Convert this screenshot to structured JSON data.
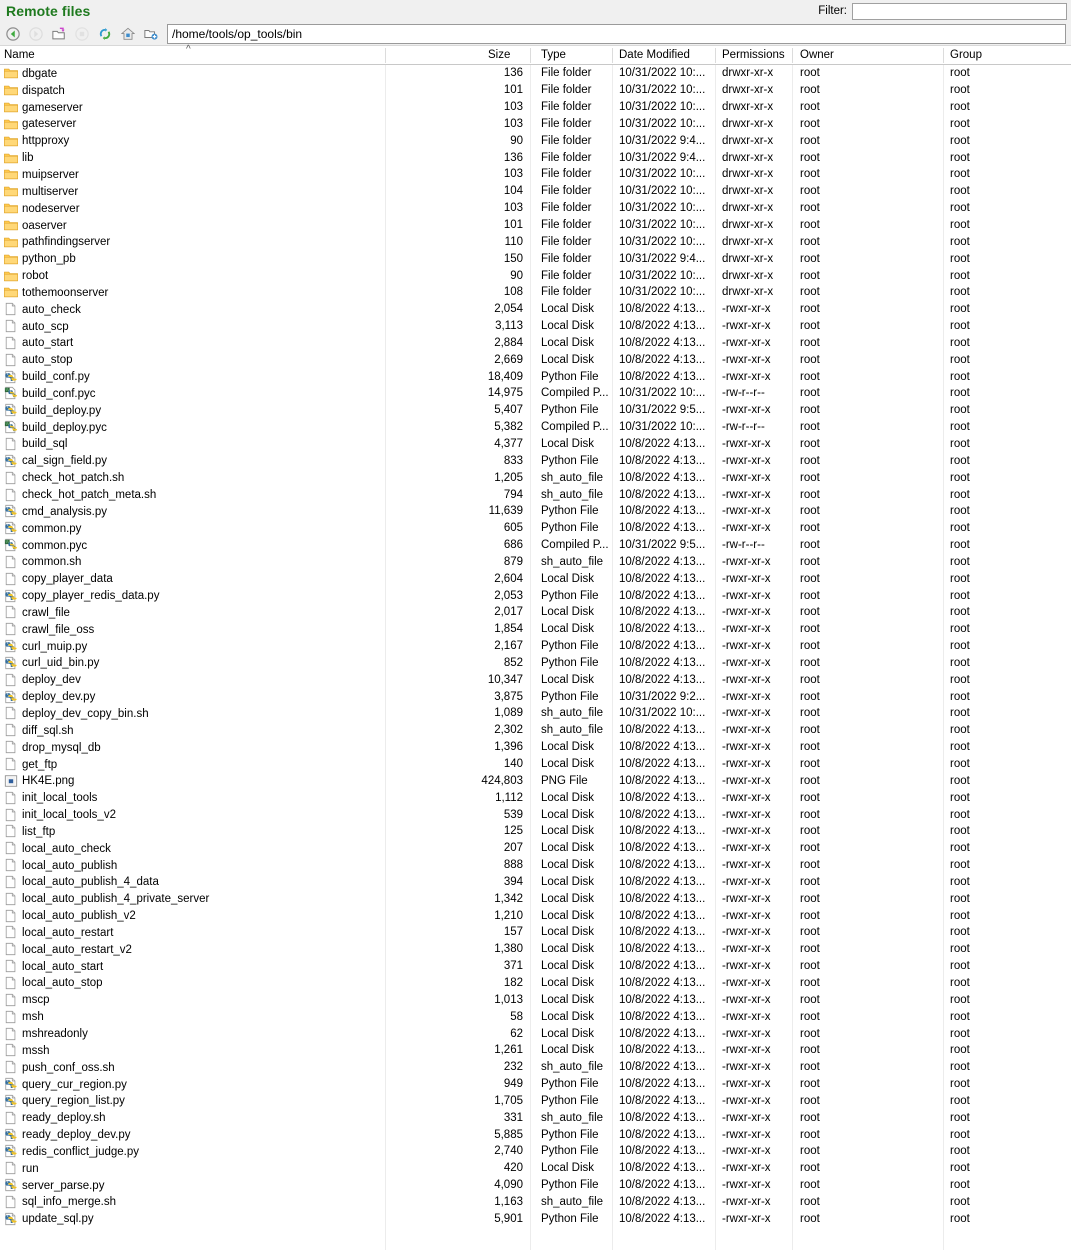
{
  "window": {
    "title": "Remote files"
  },
  "filter": {
    "label": "Filter:",
    "value": "",
    "placeholder": ""
  },
  "toolbar": {
    "buttons": [
      {
        "name": "back-icon",
        "enabled": true
      },
      {
        "name": "forward-icon",
        "enabled": false
      },
      {
        "name": "parent-directory-icon",
        "enabled": true
      },
      {
        "name": "stop-icon",
        "enabled": false
      },
      {
        "name": "refresh-icon",
        "enabled": true
      },
      {
        "name": "home-icon",
        "enabled": true
      },
      {
        "name": "new-folder-icon",
        "enabled": true
      }
    ],
    "path": "/home/tools/op_tools/bin"
  },
  "columns": {
    "name": "Name",
    "size": "Size",
    "type": "Type",
    "date_modified": "Date Modified",
    "permissions": "Permissions",
    "owner": "Owner",
    "group": "Group",
    "sort_indicator": "^",
    "sorted_by": "Name",
    "sort_direction": "ascending"
  },
  "colors": {
    "title": "#1f7a1f",
    "folder": "#ffc84a",
    "background": "#ffffff",
    "toolbar_bg": "#f0f0f0",
    "divider": "#ececec"
  },
  "files": [
    {
      "icon": "folder-icon",
      "name": "dbgate",
      "size": "136",
      "type": "File folder",
      "date": "10/31/2022 10:...",
      "perm": "drwxr-xr-x",
      "owner": "root",
      "group": "root"
    },
    {
      "icon": "folder-icon",
      "name": "dispatch",
      "size": "101",
      "type": "File folder",
      "date": "10/31/2022 10:...",
      "perm": "drwxr-xr-x",
      "owner": "root",
      "group": "root"
    },
    {
      "icon": "folder-icon",
      "name": "gameserver",
      "size": "103",
      "type": "File folder",
      "date": "10/31/2022 10:...",
      "perm": "drwxr-xr-x",
      "owner": "root",
      "group": "root"
    },
    {
      "icon": "folder-icon",
      "name": "gateserver",
      "size": "103",
      "type": "File folder",
      "date": "10/31/2022 10:...",
      "perm": "drwxr-xr-x",
      "owner": "root",
      "group": "root"
    },
    {
      "icon": "folder-icon",
      "name": "httpproxy",
      "size": "90",
      "type": "File folder",
      "date": "10/31/2022 9:4...",
      "perm": "drwxr-xr-x",
      "owner": "root",
      "group": "root"
    },
    {
      "icon": "folder-icon",
      "name": "lib",
      "size": "136",
      "type": "File folder",
      "date": "10/31/2022 9:4...",
      "perm": "drwxr-xr-x",
      "owner": "root",
      "group": "root"
    },
    {
      "icon": "folder-icon",
      "name": "muipserver",
      "size": "103",
      "type": "File folder",
      "date": "10/31/2022 10:...",
      "perm": "drwxr-xr-x",
      "owner": "root",
      "group": "root"
    },
    {
      "icon": "folder-icon",
      "name": "multiserver",
      "size": "104",
      "type": "File folder",
      "date": "10/31/2022 10:...",
      "perm": "drwxr-xr-x",
      "owner": "root",
      "group": "root"
    },
    {
      "icon": "folder-icon",
      "name": "nodeserver",
      "size": "103",
      "type": "File folder",
      "date": "10/31/2022 10:...",
      "perm": "drwxr-xr-x",
      "owner": "root",
      "group": "root"
    },
    {
      "icon": "folder-icon",
      "name": "oaserver",
      "size": "101",
      "type": "File folder",
      "date": "10/31/2022 10:...",
      "perm": "drwxr-xr-x",
      "owner": "root",
      "group": "root"
    },
    {
      "icon": "folder-icon",
      "name": "pathfindingserver",
      "size": "110",
      "type": "File folder",
      "date": "10/31/2022 10:...",
      "perm": "drwxr-xr-x",
      "owner": "root",
      "group": "root"
    },
    {
      "icon": "folder-icon",
      "name": "python_pb",
      "size": "150",
      "type": "File folder",
      "date": "10/31/2022 9:4...",
      "perm": "drwxr-xr-x",
      "owner": "root",
      "group": "root"
    },
    {
      "icon": "folder-icon",
      "name": "robot",
      "size": "90",
      "type": "File folder",
      "date": "10/31/2022 10:...",
      "perm": "drwxr-xr-x",
      "owner": "root",
      "group": "root"
    },
    {
      "icon": "folder-icon",
      "name": "tothemoonserver",
      "size": "108",
      "type": "File folder",
      "date": "10/31/2022 10:...",
      "perm": "drwxr-xr-x",
      "owner": "root",
      "group": "root"
    },
    {
      "icon": "file-icon",
      "name": "auto_check",
      "size": "2,054",
      "type": "Local Disk",
      "date": "10/8/2022 4:13...",
      "perm": "-rwxr-xr-x",
      "owner": "root",
      "group": "root"
    },
    {
      "icon": "file-icon",
      "name": "auto_scp",
      "size": "3,113",
      "type": "Local Disk",
      "date": "10/8/2022 4:13...",
      "perm": "-rwxr-xr-x",
      "owner": "root",
      "group": "root"
    },
    {
      "icon": "file-icon",
      "name": "auto_start",
      "size": "2,884",
      "type": "Local Disk",
      "date": "10/8/2022 4:13...",
      "perm": "-rwxr-xr-x",
      "owner": "root",
      "group": "root"
    },
    {
      "icon": "file-icon",
      "name": "auto_stop",
      "size": "2,669",
      "type": "Local Disk",
      "date": "10/8/2022 4:13...",
      "perm": "-rwxr-xr-x",
      "owner": "root",
      "group": "root"
    },
    {
      "icon": "python-icon",
      "name": "build_conf.py",
      "size": "18,409",
      "type": "Python File",
      "date": "10/8/2022 4:13...",
      "perm": "-rwxr-xr-x",
      "owner": "root",
      "group": "root"
    },
    {
      "icon": "pyc-icon",
      "name": "build_conf.pyc",
      "size": "14,975",
      "type": "Compiled P...",
      "date": "10/31/2022 10:...",
      "perm": "-rw-r--r--",
      "owner": "root",
      "group": "root"
    },
    {
      "icon": "python-icon",
      "name": "build_deploy.py",
      "size": "5,407",
      "type": "Python File",
      "date": "10/31/2022 9:5...",
      "perm": "-rwxr-xr-x",
      "owner": "root",
      "group": "root"
    },
    {
      "icon": "pyc-icon",
      "name": "build_deploy.pyc",
      "size": "5,382",
      "type": "Compiled P...",
      "date": "10/31/2022 10:...",
      "perm": "-rw-r--r--",
      "owner": "root",
      "group": "root"
    },
    {
      "icon": "file-icon",
      "name": "build_sql",
      "size": "4,377",
      "type": "Local Disk",
      "date": "10/8/2022 4:13...",
      "perm": "-rwxr-xr-x",
      "owner": "root",
      "group": "root"
    },
    {
      "icon": "python-icon",
      "name": "cal_sign_field.py",
      "size": "833",
      "type": "Python File",
      "date": "10/8/2022 4:13...",
      "perm": "-rwxr-xr-x",
      "owner": "root",
      "group": "root"
    },
    {
      "icon": "file-icon",
      "name": "check_hot_patch.sh",
      "size": "1,205",
      "type": "sh_auto_file",
      "date": "10/8/2022 4:13...",
      "perm": "-rwxr-xr-x",
      "owner": "root",
      "group": "root"
    },
    {
      "icon": "file-icon",
      "name": "check_hot_patch_meta.sh",
      "size": "794",
      "type": "sh_auto_file",
      "date": "10/8/2022 4:13...",
      "perm": "-rwxr-xr-x",
      "owner": "root",
      "group": "root"
    },
    {
      "icon": "python-icon",
      "name": "cmd_analysis.py",
      "size": "11,639",
      "type": "Python File",
      "date": "10/8/2022 4:13...",
      "perm": "-rwxr-xr-x",
      "owner": "root",
      "group": "root"
    },
    {
      "icon": "python-icon",
      "name": "common.py",
      "size": "605",
      "type": "Python File",
      "date": "10/8/2022 4:13...",
      "perm": "-rwxr-xr-x",
      "owner": "root",
      "group": "root"
    },
    {
      "icon": "pyc-icon",
      "name": "common.pyc",
      "size": "686",
      "type": "Compiled P...",
      "date": "10/31/2022 9:5...",
      "perm": "-rw-r--r--",
      "owner": "root",
      "group": "root"
    },
    {
      "icon": "file-icon",
      "name": "common.sh",
      "size": "879",
      "type": "sh_auto_file",
      "date": "10/8/2022 4:13...",
      "perm": "-rwxr-xr-x",
      "owner": "root",
      "group": "root"
    },
    {
      "icon": "file-icon",
      "name": "copy_player_data",
      "size": "2,604",
      "type": "Local Disk",
      "date": "10/8/2022 4:13...",
      "perm": "-rwxr-xr-x",
      "owner": "root",
      "group": "root"
    },
    {
      "icon": "python-icon",
      "name": "copy_player_redis_data.py",
      "size": "2,053",
      "type": "Python File",
      "date": "10/8/2022 4:13...",
      "perm": "-rwxr-xr-x",
      "owner": "root",
      "group": "root"
    },
    {
      "icon": "file-icon",
      "name": "crawl_file",
      "size": "2,017",
      "type": "Local Disk",
      "date": "10/8/2022 4:13...",
      "perm": "-rwxr-xr-x",
      "owner": "root",
      "group": "root"
    },
    {
      "icon": "file-icon",
      "name": "crawl_file_oss",
      "size": "1,854",
      "type": "Local Disk",
      "date": "10/8/2022 4:13...",
      "perm": "-rwxr-xr-x",
      "owner": "root",
      "group": "root"
    },
    {
      "icon": "python-icon",
      "name": "curl_muip.py",
      "size": "2,167",
      "type": "Python File",
      "date": "10/8/2022 4:13...",
      "perm": "-rwxr-xr-x",
      "owner": "root",
      "group": "root"
    },
    {
      "icon": "python-icon",
      "name": "curl_uid_bin.py",
      "size": "852",
      "type": "Python File",
      "date": "10/8/2022 4:13...",
      "perm": "-rwxr-xr-x",
      "owner": "root",
      "group": "root"
    },
    {
      "icon": "file-icon",
      "name": "deploy_dev",
      "size": "10,347",
      "type": "Local Disk",
      "date": "10/8/2022 4:13...",
      "perm": "-rwxr-xr-x",
      "owner": "root",
      "group": "root"
    },
    {
      "icon": "python-icon",
      "name": "deploy_dev.py",
      "size": "3,875",
      "type": "Python File",
      "date": "10/31/2022 9:2...",
      "perm": "-rwxr-xr-x",
      "owner": "root",
      "group": "root"
    },
    {
      "icon": "file-icon",
      "name": "deploy_dev_copy_bin.sh",
      "size": "1,089",
      "type": "sh_auto_file",
      "date": "10/31/2022 10:...",
      "perm": "-rwxr-xr-x",
      "owner": "root",
      "group": "root"
    },
    {
      "icon": "file-icon",
      "name": "diff_sql.sh",
      "size": "2,302",
      "type": "sh_auto_file",
      "date": "10/8/2022 4:13...",
      "perm": "-rwxr-xr-x",
      "owner": "root",
      "group": "root"
    },
    {
      "icon": "file-icon",
      "name": "drop_mysql_db",
      "size": "1,396",
      "type": "Local Disk",
      "date": "10/8/2022 4:13...",
      "perm": "-rwxr-xr-x",
      "owner": "root",
      "group": "root"
    },
    {
      "icon": "file-icon",
      "name": "get_ftp",
      "size": "140",
      "type": "Local Disk",
      "date": "10/8/2022 4:13...",
      "perm": "-rwxr-xr-x",
      "owner": "root",
      "group": "root"
    },
    {
      "icon": "image-icon",
      "name": "HK4E.png",
      "size": "424,803",
      "type": "PNG File",
      "date": "10/8/2022 4:13...",
      "perm": "-rwxr-xr-x",
      "owner": "root",
      "group": "root"
    },
    {
      "icon": "file-icon",
      "name": "init_local_tools",
      "size": "1,112",
      "type": "Local Disk",
      "date": "10/8/2022 4:13...",
      "perm": "-rwxr-xr-x",
      "owner": "root",
      "group": "root"
    },
    {
      "icon": "file-icon",
      "name": "init_local_tools_v2",
      "size": "539",
      "type": "Local Disk",
      "date": "10/8/2022 4:13...",
      "perm": "-rwxr-xr-x",
      "owner": "root",
      "group": "root"
    },
    {
      "icon": "file-icon",
      "name": "list_ftp",
      "size": "125",
      "type": "Local Disk",
      "date": "10/8/2022 4:13...",
      "perm": "-rwxr-xr-x",
      "owner": "root",
      "group": "root"
    },
    {
      "icon": "file-icon",
      "name": "local_auto_check",
      "size": "207",
      "type": "Local Disk",
      "date": "10/8/2022 4:13...",
      "perm": "-rwxr-xr-x",
      "owner": "root",
      "group": "root"
    },
    {
      "icon": "file-icon",
      "name": "local_auto_publish",
      "size": "888",
      "type": "Local Disk",
      "date": "10/8/2022 4:13...",
      "perm": "-rwxr-xr-x",
      "owner": "root",
      "group": "root"
    },
    {
      "icon": "file-icon",
      "name": "local_auto_publish_4_data",
      "size": "394",
      "type": "Local Disk",
      "date": "10/8/2022 4:13...",
      "perm": "-rwxr-xr-x",
      "owner": "root",
      "group": "root"
    },
    {
      "icon": "file-icon",
      "name": "local_auto_publish_4_private_server",
      "size": "1,342",
      "type": "Local Disk",
      "date": "10/8/2022 4:13...",
      "perm": "-rwxr-xr-x",
      "owner": "root",
      "group": "root"
    },
    {
      "icon": "file-icon",
      "name": "local_auto_publish_v2",
      "size": "1,210",
      "type": "Local Disk",
      "date": "10/8/2022 4:13...",
      "perm": "-rwxr-xr-x",
      "owner": "root",
      "group": "root"
    },
    {
      "icon": "file-icon",
      "name": "local_auto_restart",
      "size": "157",
      "type": "Local Disk",
      "date": "10/8/2022 4:13...",
      "perm": "-rwxr-xr-x",
      "owner": "root",
      "group": "root"
    },
    {
      "icon": "file-icon",
      "name": "local_auto_restart_v2",
      "size": "1,380",
      "type": "Local Disk",
      "date": "10/8/2022 4:13...",
      "perm": "-rwxr-xr-x",
      "owner": "root",
      "group": "root"
    },
    {
      "icon": "file-icon",
      "name": "local_auto_start",
      "size": "371",
      "type": "Local Disk",
      "date": "10/8/2022 4:13...",
      "perm": "-rwxr-xr-x",
      "owner": "root",
      "group": "root"
    },
    {
      "icon": "file-icon",
      "name": "local_auto_stop",
      "size": "182",
      "type": "Local Disk",
      "date": "10/8/2022 4:13...",
      "perm": "-rwxr-xr-x",
      "owner": "root",
      "group": "root"
    },
    {
      "icon": "file-icon",
      "name": "mscp",
      "size": "1,013",
      "type": "Local Disk",
      "date": "10/8/2022 4:13...",
      "perm": "-rwxr-xr-x",
      "owner": "root",
      "group": "root"
    },
    {
      "icon": "file-icon",
      "name": "msh",
      "size": "58",
      "type": "Local Disk",
      "date": "10/8/2022 4:13...",
      "perm": "-rwxr-xr-x",
      "owner": "root",
      "group": "root"
    },
    {
      "icon": "file-icon",
      "name": "mshreadonly",
      "size": "62",
      "type": "Local Disk",
      "date": "10/8/2022 4:13...",
      "perm": "-rwxr-xr-x",
      "owner": "root",
      "group": "root"
    },
    {
      "icon": "file-icon",
      "name": "mssh",
      "size": "1,261",
      "type": "Local Disk",
      "date": "10/8/2022 4:13...",
      "perm": "-rwxr-xr-x",
      "owner": "root",
      "group": "root"
    },
    {
      "icon": "file-icon",
      "name": "push_conf_oss.sh",
      "size": "232",
      "type": "sh_auto_file",
      "date": "10/8/2022 4:13...",
      "perm": "-rwxr-xr-x",
      "owner": "root",
      "group": "root"
    },
    {
      "icon": "python-icon",
      "name": "query_cur_region.py",
      "size": "949",
      "type": "Python File",
      "date": "10/8/2022 4:13...",
      "perm": "-rwxr-xr-x",
      "owner": "root",
      "group": "root"
    },
    {
      "icon": "python-icon",
      "name": "query_region_list.py",
      "size": "1,705",
      "type": "Python File",
      "date": "10/8/2022 4:13...",
      "perm": "-rwxr-xr-x",
      "owner": "root",
      "group": "root"
    },
    {
      "icon": "file-icon",
      "name": "ready_deploy.sh",
      "size": "331",
      "type": "sh_auto_file",
      "date": "10/8/2022 4:13...",
      "perm": "-rwxr-xr-x",
      "owner": "root",
      "group": "root"
    },
    {
      "icon": "python-icon",
      "name": "ready_deploy_dev.py",
      "size": "5,885",
      "type": "Python File",
      "date": "10/8/2022 4:13...",
      "perm": "-rwxr-xr-x",
      "owner": "root",
      "group": "root"
    },
    {
      "icon": "python-icon",
      "name": "redis_conflict_judge.py",
      "size": "2,740",
      "type": "Python File",
      "date": "10/8/2022 4:13...",
      "perm": "-rwxr-xr-x",
      "owner": "root",
      "group": "root"
    },
    {
      "icon": "file-icon",
      "name": "run",
      "size": "420",
      "type": "Local Disk",
      "date": "10/8/2022 4:13...",
      "perm": "-rwxr-xr-x",
      "owner": "root",
      "group": "root"
    },
    {
      "icon": "python-icon",
      "name": "server_parse.py",
      "size": "4,090",
      "type": "Python File",
      "date": "10/8/2022 4:13...",
      "perm": "-rwxr-xr-x",
      "owner": "root",
      "group": "root"
    },
    {
      "icon": "file-icon",
      "name": "sql_info_merge.sh",
      "size": "1,163",
      "type": "sh_auto_file",
      "date": "10/8/2022 4:13...",
      "perm": "-rwxr-xr-x",
      "owner": "root",
      "group": "root"
    },
    {
      "icon": "python-icon",
      "name": "update_sql.py",
      "size": "5,901",
      "type": "Python File",
      "date": "10/8/2022 4:13...",
      "perm": "-rwxr-xr-x",
      "owner": "root",
      "group": "root"
    }
  ]
}
